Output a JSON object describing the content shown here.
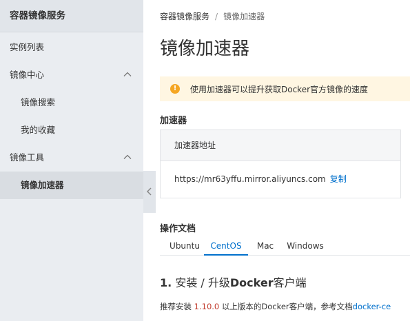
{
  "sidebar": {
    "title": "容器镜像服务",
    "items": [
      {
        "label": "实例列表"
      },
      {
        "label": "镜像中心"
      },
      {
        "label": "镜像搜索"
      },
      {
        "label": "我的收藏"
      },
      {
        "label": "镜像工具"
      },
      {
        "label": "镜像加速器"
      }
    ]
  },
  "breadcrumb": {
    "root": "容器镜像服务",
    "separator": "/",
    "current": "镜像加速器"
  },
  "page_title": "镜像加速器",
  "notice": {
    "icon": "!",
    "text": "使用加速器可以提升获取Docker官方镜像的速度"
  },
  "accelerator": {
    "section_title": "加速器",
    "header": "加速器地址",
    "url": "https://mr63yffu.mirror.aliyuncs.com",
    "copy_label": "复制"
  },
  "docs": {
    "section_title": "操作文档",
    "tabs": [
      "Ubuntu",
      "CentOS",
      "Mac",
      "Windows"
    ],
    "active_tab": "CentOS",
    "step": {
      "number": "1.",
      "title_a": "安装 / 升级",
      "title_b": "Docker",
      "title_c": "客户端",
      "desc_prefix": "推荐安装",
      "version": "1.10.0",
      "desc_middle": "以上版本的Docker客户端，参考文档",
      "link": "docker-ce"
    }
  },
  "colors": {
    "accent": "#0070cc",
    "warning": "#f5a623",
    "notice_bg": "#fff6e2",
    "sidebar_bg": "#eaedf1"
  }
}
